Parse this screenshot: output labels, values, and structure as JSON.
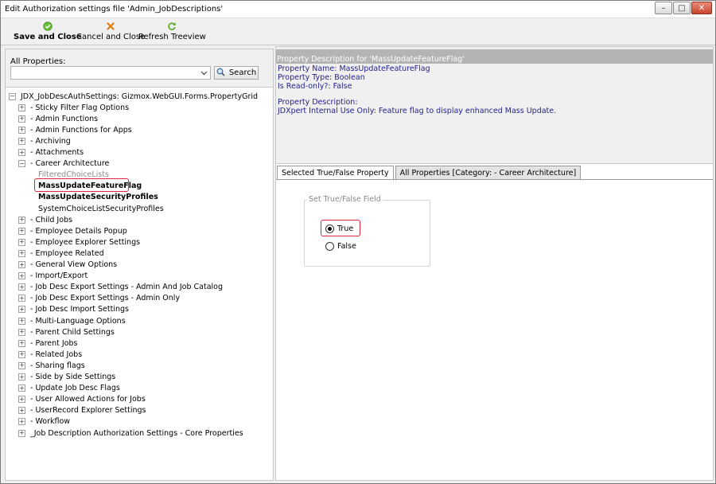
{
  "window": {
    "title": "Edit Authorization settings file 'Admin_JobDescriptions'"
  },
  "toolbar": {
    "save_close": "Save and Close",
    "cancel_close": "Cancel and Close",
    "refresh": "Refresh Treeview"
  },
  "left": {
    "all_props_label": "All Properties:",
    "combo_value": "",
    "search_label": "Search",
    "root_label": "JDX_JobDescAuthSettings: Gizmox.WebGUI.Forms.PropertyGrid",
    "tree_items": [
      {
        "label": "- Sticky Filter Flag Options",
        "expander": "+"
      },
      {
        "label": "- Admin Functions",
        "expander": "+"
      },
      {
        "label": "- Admin Functions for Apps",
        "expander": "+"
      },
      {
        "label": "- Archiving",
        "expander": "+"
      },
      {
        "label": "- Attachments",
        "expander": "+"
      },
      {
        "label": "- Career Architecture",
        "expander": "-"
      },
      {
        "label": "- Child Jobs",
        "expander": "+"
      },
      {
        "label": "- Employee Details Popup",
        "expander": "+"
      },
      {
        "label": "- Employee Explorer Settings",
        "expander": "+"
      },
      {
        "label": "- Employee Related",
        "expander": "+"
      },
      {
        "label": "- General View Options",
        "expander": "+"
      },
      {
        "label": "- Import/Export",
        "expander": "+"
      },
      {
        "label": "- Job Desc Export Settings - Admin And Job Catalog",
        "expander": "+"
      },
      {
        "label": "- Job Desc Export Settings - Admin Only",
        "expander": "+"
      },
      {
        "label": "- Job Desc Import Settings",
        "expander": "+"
      },
      {
        "label": "- Multi-Language Options",
        "expander": "+"
      },
      {
        "label": "- Parent Child Settings",
        "expander": "+"
      },
      {
        "label": "- Parent Jobs",
        "expander": "+"
      },
      {
        "label": "- Related Jobs",
        "expander": "+"
      },
      {
        "label": "- Sharing flags",
        "expander": "+"
      },
      {
        "label": "- Side by Side Settings",
        "expander": "+"
      },
      {
        "label": "- Update Job Desc Flags",
        "expander": "+"
      },
      {
        "label": "- User Allowed Actions for Jobs",
        "expander": "+"
      },
      {
        "label": "- UserRecord Explorer Settings",
        "expander": "+"
      },
      {
        "label": "- Workflow",
        "expander": "+"
      },
      {
        "label": "_Job Description Authorization Settings - Core Properties",
        "expander": "+"
      }
    ],
    "career_children": [
      {
        "label": "FilteredChoiceLists",
        "style": "dim"
      },
      {
        "label": "MassUpdateFeatureFlag",
        "style": "bold"
      },
      {
        "label": "MassUpdateSecurityProfiles",
        "style": "bold"
      },
      {
        "label": "SystemChoiceListSecurityProfiles",
        "style": "normal"
      }
    ]
  },
  "description": {
    "header": "Property Description for 'MassUpdateFeatureFlag'",
    "name_line": "Property Name: MassUpdateFeatureFlag",
    "type_line": "Property Type: Boolean",
    "readonly_line": "Is Read-only?: False",
    "desc_label": "Property Description:",
    "desc_text": "JDXpert Internal Use Only: Feature flag to display enhanced Mass Update."
  },
  "tabs": {
    "selected": "Selected True/False Property",
    "all": "All Properties [Category: - Career Architecture]"
  },
  "field": {
    "group_title": "Set True/False Field",
    "true_label": "True",
    "false_label": "False",
    "value": true
  },
  "colors": {
    "highlight": "#e0263c",
    "desc_text": "#1f1f8f",
    "desc_header_bg": "#b4b4b4"
  }
}
